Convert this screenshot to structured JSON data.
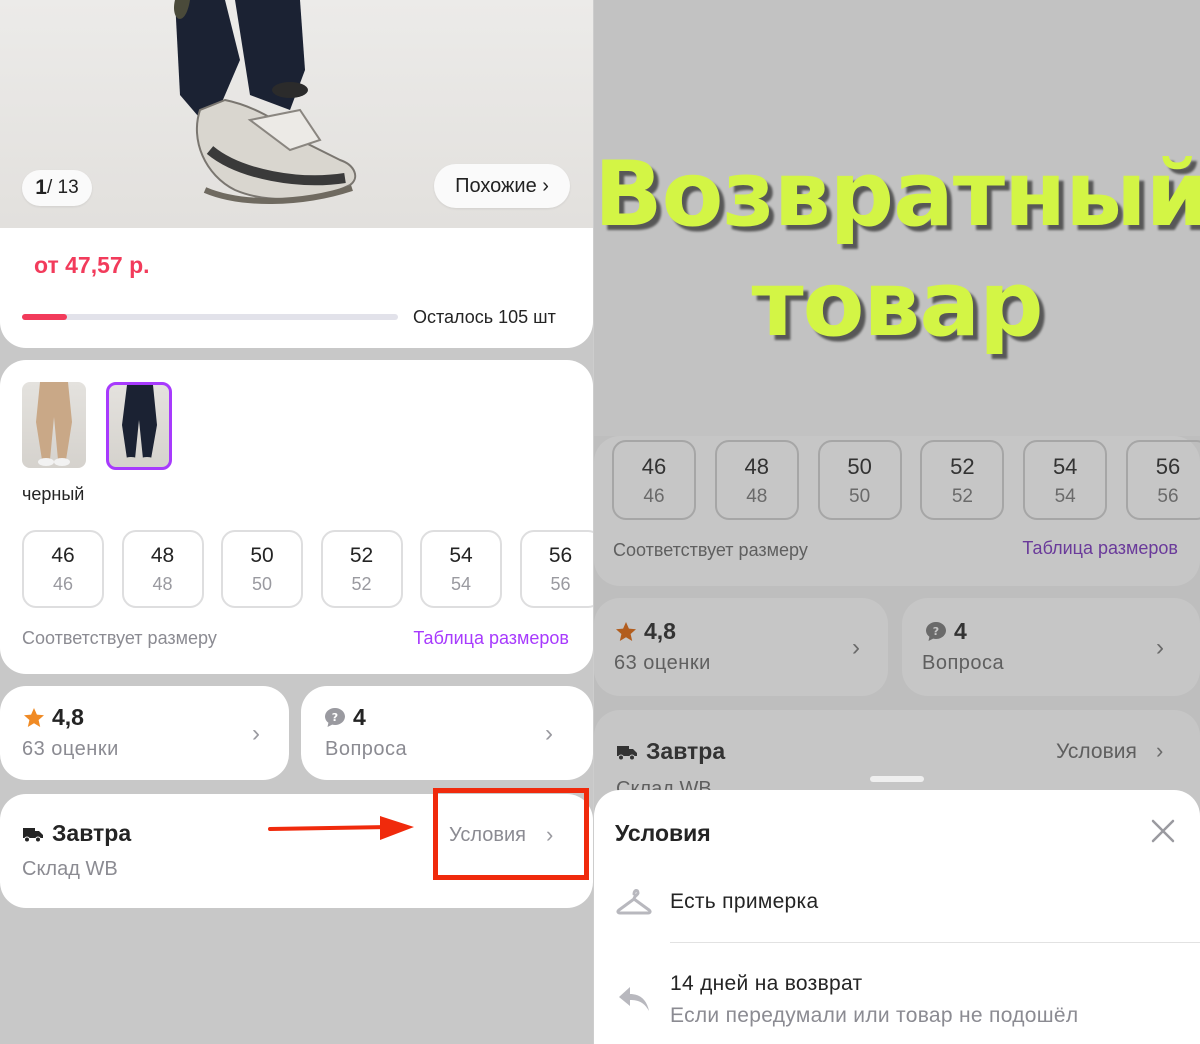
{
  "left": {
    "gallery": {
      "current": "1",
      "total": "13",
      "similar_label": "Похожие ›"
    },
    "price_label": "от 47,57 р.",
    "stock": {
      "label": "Осталось 105 шт",
      "progress_fraction": 0.12
    },
    "color_label": "черный",
    "sizes": [
      {
        "size": "46",
        "ru": "46"
      },
      {
        "size": "48",
        "ru": "48"
      },
      {
        "size": "50",
        "ru": "50"
      },
      {
        "size": "52",
        "ru": "52"
      },
      {
        "size": "54",
        "ru": "54"
      },
      {
        "size": "56",
        "ru": "56"
      }
    ],
    "fits_label": "Соответствует размеру",
    "size_table_label": "Таблица размеров",
    "rating": {
      "value": "4,8",
      "count_label": "63 оценки"
    },
    "questions": {
      "value": "4",
      "label": "Вопроса"
    },
    "delivery": {
      "when": "Завтра",
      "warehouse": "Склад WB",
      "conditions_label": "Условия"
    }
  },
  "right": {
    "overlay_title_line1": "Возвратный",
    "overlay_title_line2": "товар",
    "sizes": [
      {
        "size": "46",
        "ru": "46"
      },
      {
        "size": "48",
        "ru": "48"
      },
      {
        "size": "50",
        "ru": "50"
      },
      {
        "size": "52",
        "ru": "52"
      },
      {
        "size": "54",
        "ru": "54"
      },
      {
        "size": "56",
        "ru": "56"
      }
    ],
    "fits_label": "Соответствует размеру",
    "size_table_label": "Таблица размеров",
    "rating": {
      "value": "4,8",
      "count_label": "63 оценки"
    },
    "questions": {
      "value": "4",
      "label": "Вопроса"
    },
    "delivery": {
      "when": "Завтра",
      "warehouse": "Склад WB",
      "conditions_label": "Условия"
    },
    "sheet": {
      "title": "Условия",
      "fitting": "Есть примерка",
      "return_title": "14 дней на возврат",
      "return_sub": "Если передумали или товар не подошёл"
    }
  },
  "colors": {
    "accent_purple": "#a73afd",
    "price_red": "#f23b5b",
    "highlight_red": "#f02a0c",
    "title_green": "#d3f545",
    "star_orange": "#f08a24"
  }
}
